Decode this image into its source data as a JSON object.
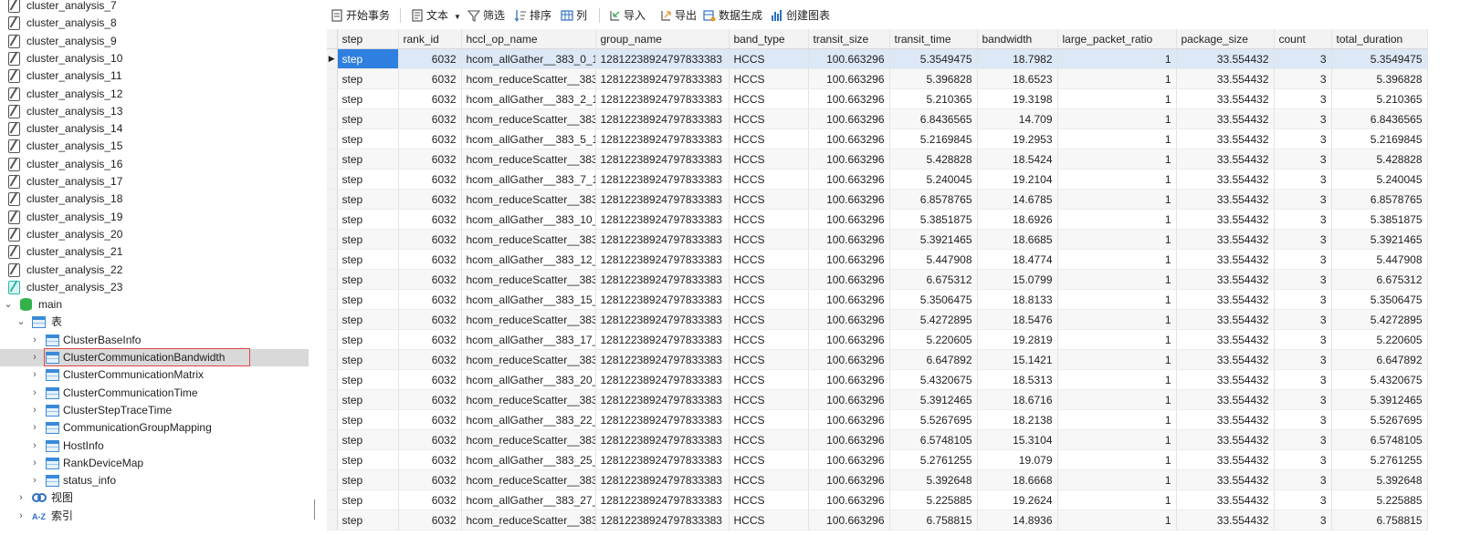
{
  "sidebar": {
    "analysis_items": [
      "cluster_analysis_7",
      "cluster_analysis_8",
      "cluster_analysis_9",
      "cluster_analysis_10",
      "cluster_analysis_11",
      "cluster_analysis_12",
      "cluster_analysis_13",
      "cluster_analysis_14",
      "cluster_analysis_15",
      "cluster_analysis_16",
      "cluster_analysis_17",
      "cluster_analysis_18",
      "cluster_analysis_19",
      "cluster_analysis_20",
      "cluster_analysis_21",
      "cluster_analysis_22",
      "cluster_analysis_23"
    ],
    "schema": "main",
    "tables_group": "表",
    "tables": [
      "ClusterBaseInfo",
      "ClusterCommunicationBandwidth",
      "ClusterCommunicationMatrix",
      "ClusterCommunicationTime",
      "ClusterStepTraceTime",
      "CommunicationGroupMapping",
      "HostInfo",
      "RankDeviceMap",
      "status_info"
    ],
    "selected_table": "ClusterCommunicationBandwidth",
    "views_group": "视图",
    "index_group": "索引",
    "index_icon_text": "A-Z"
  },
  "toolbar": {
    "begin_transaction": "开始事务",
    "text": "文本",
    "filter": "筛选",
    "sort": "排序",
    "columns": "列",
    "import": "导入",
    "export": "导出",
    "data_generation": "数据生成",
    "create_chart": "创建图表"
  },
  "grid": {
    "columns": [
      "step",
      "rank_id",
      "hccl_op_name",
      "group_name",
      "band_type",
      "transit_size",
      "transit_time",
      "bandwidth",
      "large_packet_ratio",
      "package_size",
      "count",
      "total_duration"
    ],
    "rows": [
      [
        "step",
        "6032",
        "hcom_allGather__383_0_1",
        "12812238924797833383",
        "HCCS",
        "100.663296",
        "5.3549475",
        "18.7982",
        "1",
        "33.554432",
        "3",
        "5.3549475"
      ],
      [
        "step",
        "6032",
        "hcom_reduceScatter__383",
        "12812238924797833383",
        "HCCS",
        "100.663296",
        "5.396828",
        "18.6523",
        "1",
        "33.554432",
        "3",
        "5.396828"
      ],
      [
        "step",
        "6032",
        "hcom_allGather__383_2_1",
        "12812238924797833383",
        "HCCS",
        "100.663296",
        "5.210365",
        "19.3198",
        "1",
        "33.554432",
        "3",
        "5.210365"
      ],
      [
        "step",
        "6032",
        "hcom_reduceScatter__383",
        "12812238924797833383",
        "HCCS",
        "100.663296",
        "6.8436565",
        "14.709",
        "1",
        "33.554432",
        "3",
        "6.8436565"
      ],
      [
        "step",
        "6032",
        "hcom_allGather__383_5_1",
        "12812238924797833383",
        "HCCS",
        "100.663296",
        "5.2169845",
        "19.2953",
        "1",
        "33.554432",
        "3",
        "5.2169845"
      ],
      [
        "step",
        "6032",
        "hcom_reduceScatter__383",
        "12812238924797833383",
        "HCCS",
        "100.663296",
        "5.428828",
        "18.5424",
        "1",
        "33.554432",
        "3",
        "5.428828"
      ],
      [
        "step",
        "6032",
        "hcom_allGather__383_7_1",
        "12812238924797833383",
        "HCCS",
        "100.663296",
        "5.240045",
        "19.2104",
        "1",
        "33.554432",
        "3",
        "5.240045"
      ],
      [
        "step",
        "6032",
        "hcom_reduceScatter__383",
        "12812238924797833383",
        "HCCS",
        "100.663296",
        "6.8578765",
        "14.6785",
        "1",
        "33.554432",
        "3",
        "6.8578765"
      ],
      [
        "step",
        "6032",
        "hcom_allGather__383_10_",
        "12812238924797833383",
        "HCCS",
        "100.663296",
        "5.3851875",
        "18.6926",
        "1",
        "33.554432",
        "3",
        "5.3851875"
      ],
      [
        "step",
        "6032",
        "hcom_reduceScatter__383",
        "12812238924797833383",
        "HCCS",
        "100.663296",
        "5.3921465",
        "18.6685",
        "1",
        "33.554432",
        "3",
        "5.3921465"
      ],
      [
        "step",
        "6032",
        "hcom_allGather__383_12_",
        "12812238924797833383",
        "HCCS",
        "100.663296",
        "5.447908",
        "18.4774",
        "1",
        "33.554432",
        "3",
        "5.447908"
      ],
      [
        "step",
        "6032",
        "hcom_reduceScatter__383",
        "12812238924797833383",
        "HCCS",
        "100.663296",
        "6.675312",
        "15.0799",
        "1",
        "33.554432",
        "3",
        "6.675312"
      ],
      [
        "step",
        "6032",
        "hcom_allGather__383_15_",
        "12812238924797833383",
        "HCCS",
        "100.663296",
        "5.3506475",
        "18.8133",
        "1",
        "33.554432",
        "3",
        "5.3506475"
      ],
      [
        "step",
        "6032",
        "hcom_reduceScatter__383",
        "12812238924797833383",
        "HCCS",
        "100.663296",
        "5.4272895",
        "18.5476",
        "1",
        "33.554432",
        "3",
        "5.4272895"
      ],
      [
        "step",
        "6032",
        "hcom_allGather__383_17_",
        "12812238924797833383",
        "HCCS",
        "100.663296",
        "5.220605",
        "19.2819",
        "1",
        "33.554432",
        "3",
        "5.220605"
      ],
      [
        "step",
        "6032",
        "hcom_reduceScatter__383",
        "12812238924797833383",
        "HCCS",
        "100.663296",
        "6.647892",
        "15.1421",
        "1",
        "33.554432",
        "3",
        "6.647892"
      ],
      [
        "step",
        "6032",
        "hcom_allGather__383_20_",
        "12812238924797833383",
        "HCCS",
        "100.663296",
        "5.4320675",
        "18.5313",
        "1",
        "33.554432",
        "3",
        "5.4320675"
      ],
      [
        "step",
        "6032",
        "hcom_reduceScatter__383",
        "12812238924797833383",
        "HCCS",
        "100.663296",
        "5.3912465",
        "18.6716",
        "1",
        "33.554432",
        "3",
        "5.3912465"
      ],
      [
        "step",
        "6032",
        "hcom_allGather__383_22_",
        "12812238924797833383",
        "HCCS",
        "100.663296",
        "5.5267695",
        "18.2138",
        "1",
        "33.554432",
        "3",
        "5.5267695"
      ],
      [
        "step",
        "6032",
        "hcom_reduceScatter__383",
        "12812238924797833383",
        "HCCS",
        "100.663296",
        "6.5748105",
        "15.3104",
        "1",
        "33.554432",
        "3",
        "6.5748105"
      ],
      [
        "step",
        "6032",
        "hcom_allGather__383_25_",
        "12812238924797833383",
        "HCCS",
        "100.663296",
        "5.2761255",
        "19.079",
        "1",
        "33.554432",
        "3",
        "5.2761255"
      ],
      [
        "step",
        "6032",
        "hcom_reduceScatter__383",
        "12812238924797833383",
        "HCCS",
        "100.663296",
        "5.392648",
        "18.6668",
        "1",
        "33.554432",
        "3",
        "5.392648"
      ],
      [
        "step",
        "6032",
        "hcom_allGather__383_27_",
        "12812238924797833383",
        "HCCS",
        "100.663296",
        "5.225885",
        "19.2624",
        "1",
        "33.554432",
        "3",
        "5.225885"
      ],
      [
        "step",
        "6032",
        "hcom_reduceScatter__383",
        "12812238924797833383",
        "HCCS",
        "100.663296",
        "6.758815",
        "14.8936",
        "1",
        "33.554432",
        "3",
        "6.758815"
      ]
    ],
    "current_row_marker": "▶"
  },
  "colors": {
    "selected_cell": "#2f7fe0",
    "current_row": "#dde8f6",
    "highlight_box": "#e04848",
    "table_icon": "#3b8ad9",
    "db_icon": "#34b24a"
  }
}
